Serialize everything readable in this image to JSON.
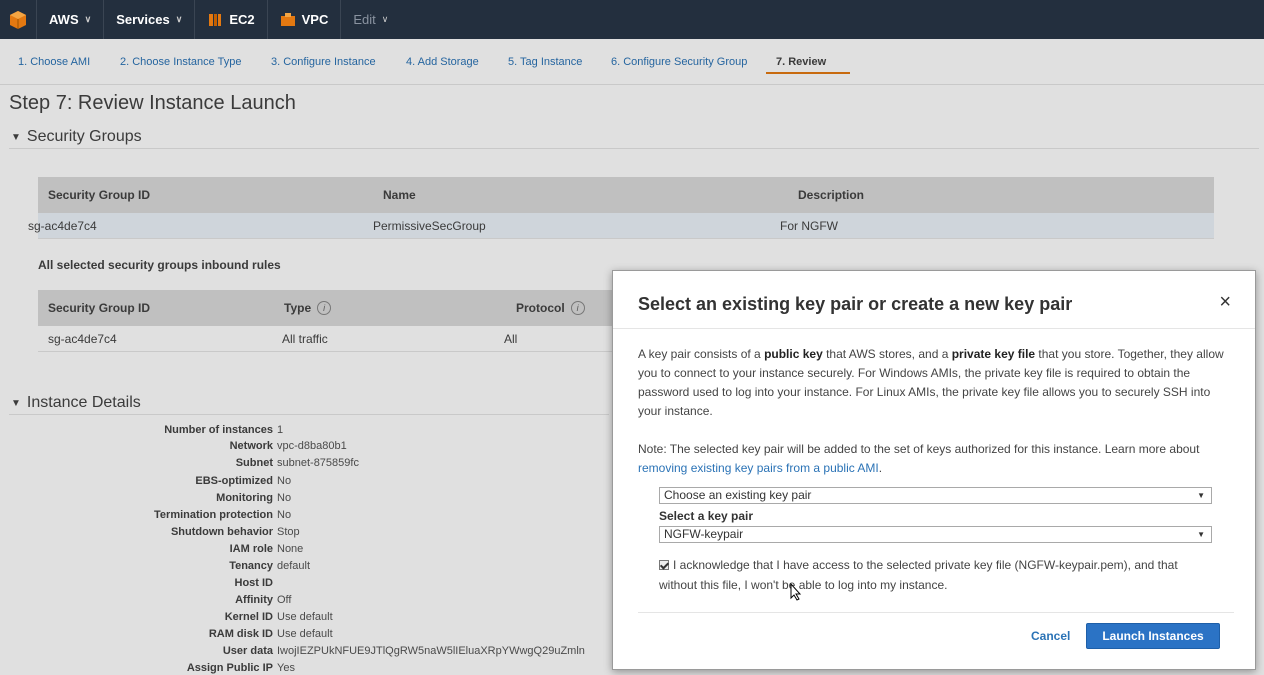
{
  "topnav": {
    "aws_label": "AWS",
    "services_label": "Services",
    "ec2_label": "EC2",
    "vpc_label": "VPC",
    "edit_label": "Edit"
  },
  "wizard": {
    "tabs": [
      {
        "label": "1. Choose AMI"
      },
      {
        "label": "2. Choose Instance Type"
      },
      {
        "label": "3. Configure Instance"
      },
      {
        "label": "4. Add Storage"
      },
      {
        "label": "5. Tag Instance"
      },
      {
        "label": "6. Configure Security Group"
      },
      {
        "label": "7. Review"
      }
    ]
  },
  "page": {
    "title": "Step 7: Review Instance Launch"
  },
  "security_groups": {
    "heading": "Security Groups",
    "columns": [
      "Security Group ID",
      "Name",
      "Description"
    ],
    "rows": [
      {
        "id": "sg-ac4de7c4",
        "name": "PermissiveSecGroup",
        "description": "For NGFW"
      }
    ],
    "inbound_heading": "All selected security groups inbound rules",
    "inbound_columns": [
      "Security Group ID",
      "Type",
      "Protocol"
    ],
    "inbound_rows": [
      {
        "id": "sg-ac4de7c4",
        "type": "All traffic",
        "protocol": "All"
      }
    ]
  },
  "instance_details": {
    "heading": "Instance Details",
    "rows": [
      {
        "label": "Number of instances",
        "value": "1"
      },
      {
        "label": "Network",
        "value": "vpc-d8ba80b1"
      },
      {
        "label": "Subnet",
        "value": "subnet-875859fc"
      },
      {
        "label": "EBS-optimized",
        "value": "No"
      },
      {
        "label": "Monitoring",
        "value": "No"
      },
      {
        "label": "Termination protection",
        "value": "No"
      },
      {
        "label": "Shutdown behavior",
        "value": "Stop"
      },
      {
        "label": "IAM role",
        "value": "None"
      },
      {
        "label": "Tenancy",
        "value": "default"
      },
      {
        "label": "Host ID",
        "value": ""
      },
      {
        "label": "Affinity",
        "value": "Off"
      },
      {
        "label": "Kernel ID",
        "value": "Use default"
      },
      {
        "label": "RAM disk ID",
        "value": "Use default"
      },
      {
        "label": "User data",
        "value": "IwojIEZPUkNFUE9JTlQgRW5naW5lIEluaXRpYWwgQ29uZmln"
      },
      {
        "label": "Assign Public IP",
        "value": "Yes"
      }
    ]
  },
  "modal": {
    "title": "Select an existing key pair or create a new key pair",
    "close": "×",
    "para1_a": "A key pair consists of a ",
    "para1_b": "public key",
    "para1_c": " that AWS stores, and a ",
    "para1_d": "private key file",
    "para1_e": " that you store. Together, they allow you to connect to your instance securely. For Windows AMIs, the private key file is required to obtain the password used to log into your instance. For Linux AMIs, the private key file allows you to securely SSH into your instance.",
    "para2_a": "Note: The selected key pair will be added to the set of keys authorized for this instance. Learn more about ",
    "para2_link": "removing existing key pairs from a public AMI",
    "para2_b": ".",
    "key_option": "Choose an existing key pair",
    "select_label": "Select a key pair",
    "key_pair": "NGFW-keypair",
    "ack_text": "I acknowledge that I have access to the selected private key file (NGFW-keypair.pem), and that without this file, I won't be able to log into my instance.",
    "cancel_label": "Cancel",
    "launch_label": "Launch Instances"
  },
  "colors": {
    "nav_bg": "#232f3e",
    "link": "#2b73b6",
    "accent": "#e47911",
    "primary_button": "#2b73c5"
  }
}
